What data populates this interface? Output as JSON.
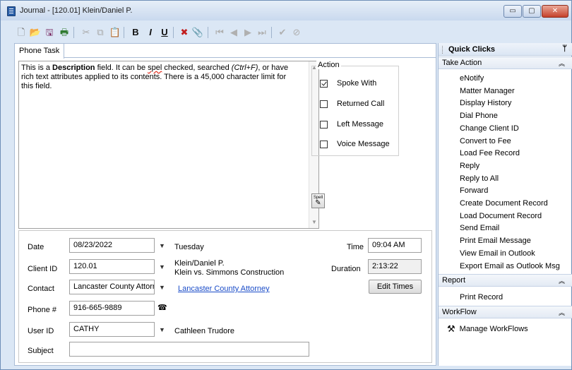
{
  "window": {
    "title": "Journal - [120.01] Klein/Daniel P.",
    "min_glyph": "▭",
    "max_glyph": "▢",
    "close_glyph": "✕"
  },
  "toolbar": {
    "buttons": [
      {
        "name": "new-document-icon",
        "glyph": "🗋",
        "color": "#777777"
      },
      {
        "name": "open-folder-icon",
        "glyph": "📂",
        "color": "#c9941e"
      },
      {
        "name": "save-icon",
        "glyph": "🖫",
        "color": "#7a2b63"
      },
      {
        "name": "print-icon",
        "glyph": "🖶",
        "color": "#2f7a2f"
      },
      {
        "name": "cut-icon",
        "glyph": "✂",
        "color": "#a8a8a8"
      },
      {
        "name": "copy-icon",
        "glyph": "⧉",
        "color": "#a8a8a8"
      },
      {
        "name": "paste-icon",
        "glyph": "📋",
        "color": "#a8a8a8"
      },
      {
        "name": "bold-icon",
        "glyph": "B",
        "color": "#111111"
      },
      {
        "name": "italic-icon",
        "glyph": "I",
        "color": "#111111"
      },
      {
        "name": "underline-icon",
        "glyph": "U",
        "color": "#111111"
      },
      {
        "name": "delete-icon",
        "glyph": "✖",
        "color": "#c21f1f"
      },
      {
        "name": "attach-icon",
        "glyph": "📎",
        "color": "#555555"
      },
      {
        "name": "first-record-icon",
        "glyph": "⏮",
        "color": "#b0b0b0"
      },
      {
        "name": "previous-record-icon",
        "glyph": "◀",
        "color": "#b0b0b0"
      },
      {
        "name": "next-record-icon",
        "glyph": "▶",
        "color": "#b0b0b0"
      },
      {
        "name": "last-record-icon",
        "glyph": "⏭",
        "color": "#b0b0b0"
      },
      {
        "name": "approve-icon",
        "glyph": "✔",
        "color": "#b0b0b0"
      },
      {
        "name": "cancel-icon",
        "glyph": "⊘",
        "color": "#b0b0b0"
      }
    ]
  },
  "tabs": [
    {
      "label": "Phone Task"
    }
  ],
  "description": {
    "part1": "This is a ",
    "bold": "Description",
    "part2": " field. It can be ",
    "misspelled": "spel",
    "part3": " checked, searched ",
    "italic": "(Ctrl+F)",
    "part4": ", or have rich text attributes applied to its contents. There is a 45,000 character limit for this field."
  },
  "action": {
    "legend": "Action",
    "options": [
      {
        "label": "Spoke With",
        "checked": true
      },
      {
        "label": "Returned Call",
        "checked": false
      },
      {
        "label": "Left Message",
        "checked": false
      },
      {
        "label": "Voice Message",
        "checked": false
      }
    ],
    "spell_label": "Spell"
  },
  "form": {
    "date": {
      "label": "Date",
      "value": "08/23/2022",
      "weekday": "Tuesday"
    },
    "time": {
      "label": "Time",
      "value": "09:04 AM"
    },
    "client": {
      "label": "Client ID",
      "value": "120.01",
      "name": "Klein/Daniel P.",
      "matter": "Klein vs. Simmons Construction"
    },
    "duration": {
      "label": "Duration",
      "value": "2:13:22"
    },
    "contact": {
      "label": "Contact",
      "value": "Lancaster County Attorr",
      "link": "Lancaster County Attorney"
    },
    "edit_times": "Edit Times",
    "phone": {
      "label": "Phone #",
      "value": "916-665-9889"
    },
    "user": {
      "label": "User ID",
      "value": "CATHY",
      "name": "Cathleen Trudore"
    },
    "subject": {
      "label": "Subject",
      "value": ""
    }
  },
  "quick_clicks": {
    "title": "Quick Clicks",
    "pin_glyph": "📌",
    "sections": [
      {
        "title": "Take Action",
        "items": [
          "eNotify",
          "Matter Manager",
          "Display History",
          "Dial Phone",
          "Change Client ID",
          "Convert to Fee",
          "Load Fee Record",
          "Reply",
          "Reply to All",
          "Forward",
          "Create Document Record",
          "Load Document Record",
          "Send Email",
          "Print Email Message",
          "View Email in Outlook",
          "Export Email as Outlook Msg"
        ]
      },
      {
        "title": "Report",
        "items": [
          "Print Record"
        ]
      },
      {
        "title": "WorkFlow",
        "items": [
          "Manage WorkFlows"
        ]
      }
    ]
  }
}
